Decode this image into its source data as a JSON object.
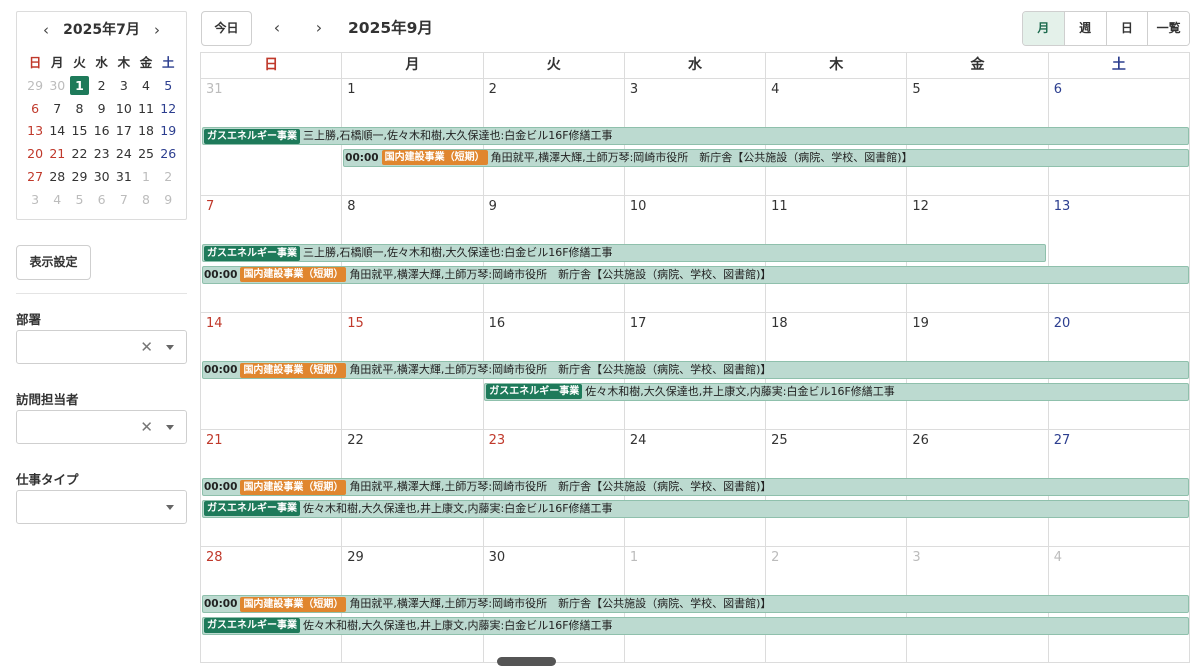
{
  "mini_calendar": {
    "prev": "‹",
    "next": "›",
    "title": "2025年7月",
    "dow": [
      "日",
      "月",
      "火",
      "水",
      "木",
      "金",
      "土"
    ],
    "weeks": [
      [
        "29",
        "30",
        "1",
        "2",
        "3",
        "4",
        "5"
      ],
      [
        "6",
        "7",
        "8",
        "9",
        "10",
        "11",
        "12"
      ],
      [
        "13",
        "14",
        "15",
        "16",
        "17",
        "18",
        "19"
      ],
      [
        "20",
        "21",
        "22",
        "23",
        "24",
        "25",
        "26"
      ],
      [
        "27",
        "28",
        "29",
        "30",
        "31",
        "1",
        "2"
      ],
      [
        "3",
        "4",
        "5",
        "6",
        "7",
        "8",
        "9"
      ]
    ],
    "today": "1"
  },
  "sidebar": {
    "display_settings": "表示設定",
    "filters": [
      {
        "label": "部署",
        "value": "",
        "clear": "✕"
      },
      {
        "label": "訪問担当者",
        "value": "",
        "clear": "✕"
      },
      {
        "label": "仕事タイプ",
        "value": "",
        "clear": ""
      }
    ]
  },
  "toolbar": {
    "today": "今日",
    "prev": "‹",
    "next": "›",
    "title": "2025年9月",
    "views": [
      "月",
      "週",
      "日",
      "一覧"
    ],
    "active_view": "月"
  },
  "month": {
    "dow": [
      "日",
      "月",
      "火",
      "水",
      "木",
      "金",
      "土"
    ],
    "weeks": [
      {
        "days": [
          "31",
          "1",
          "2",
          "3",
          "4",
          "5",
          "6"
        ]
      },
      {
        "days": [
          "7",
          "8",
          "9",
          "10",
          "11",
          "12",
          "13"
        ]
      },
      {
        "days": [
          "14",
          "15",
          "16",
          "17",
          "18",
          "19",
          "20"
        ]
      },
      {
        "days": [
          "21",
          "22",
          "23",
          "24",
          "25",
          "26",
          "27"
        ]
      },
      {
        "days": [
          "28",
          "29",
          "30",
          "1",
          "2",
          "3",
          "4"
        ]
      }
    ]
  },
  "events": [
    {
      "week": 0,
      "start": 0,
      "end": 7,
      "slot": 0,
      "time": "",
      "tag": "ガスエネルギー事業",
      "type": "gas",
      "text": "三上勝,石橋順一,佐々木和樹,大久保達也:白金ビル16F修繕工事"
    },
    {
      "week": 0,
      "start": 1,
      "end": 7,
      "slot": 1,
      "time": "00:00",
      "tag": "国内建設事業（短期）",
      "type": "dom",
      "text": "角田就平,横澤大輝,土師万琴:岡崎市役所　新庁舎【公共施設（病院、学校、図書館)】"
    },
    {
      "week": 1,
      "start": 0,
      "end": 6,
      "slot": 0,
      "time": "",
      "tag": "ガスエネルギー事業",
      "type": "gas",
      "text": "三上勝,石橋順一,佐々木和樹,大久保達也:白金ビル16F修繕工事"
    },
    {
      "week": 1,
      "start": 0,
      "end": 7,
      "slot": 1,
      "time": "00:00",
      "tag": "国内建設事業（短期）",
      "type": "dom",
      "text": "角田就平,横澤大輝,土師万琴:岡崎市役所　新庁舎【公共施設（病院、学校、図書館)】"
    },
    {
      "week": 2,
      "start": 0,
      "end": 7,
      "slot": 0,
      "time": "00:00",
      "tag": "国内建設事業（短期）",
      "type": "dom",
      "text": "角田就平,横澤大輝,土師万琴:岡崎市役所　新庁舎【公共施設（病院、学校、図書館)】"
    },
    {
      "week": 2,
      "start": 2,
      "end": 7,
      "slot": 1,
      "time": "",
      "tag": "ガスエネルギー事業",
      "type": "gas",
      "text": "佐々木和樹,大久保達也,井上康文,内藤実:白金ビル16F修繕工事"
    },
    {
      "week": 3,
      "start": 0,
      "end": 7,
      "slot": 0,
      "time": "00:00",
      "tag": "国内建設事業（短期）",
      "type": "dom",
      "text": "角田就平,横澤大輝,土師万琴:岡崎市役所　新庁舎【公共施設（病院、学校、図書館)】"
    },
    {
      "week": 3,
      "start": 0,
      "end": 7,
      "slot": 1,
      "time": "",
      "tag": "ガスエネルギー事業",
      "type": "gas",
      "text": "佐々木和樹,大久保達也,井上康文,内藤実:白金ビル16F修繕工事"
    },
    {
      "week": 4,
      "start": 0,
      "end": 7,
      "slot": 0,
      "time": "00:00",
      "tag": "国内建設事業（短期）",
      "type": "dom",
      "text": "角田就平,横澤大輝,土師万琴:岡崎市役所　新庁舎【公共施設（病院、学校、図書館)】"
    },
    {
      "week": 4,
      "start": 0,
      "end": 7,
      "slot": 1,
      "time": "",
      "tag": "ガスエネルギー事業",
      "type": "gas",
      "text": "佐々木和樹,大久保達也,井上康文,内藤実:白金ビル16F修繕工事"
    }
  ],
  "colors": {
    "accent": "#1e7a5a",
    "gas_tag": "#1e7a5a",
    "domestic_tag": "#e0862f",
    "event_bg": "#bcdad0",
    "sunday": "#c0392b",
    "saturday": "#2c3e8f",
    "holiday": "#c0392b",
    "other_month": "#bcbcbc"
  },
  "holidays_sep": [
    "15",
    "23"
  ]
}
